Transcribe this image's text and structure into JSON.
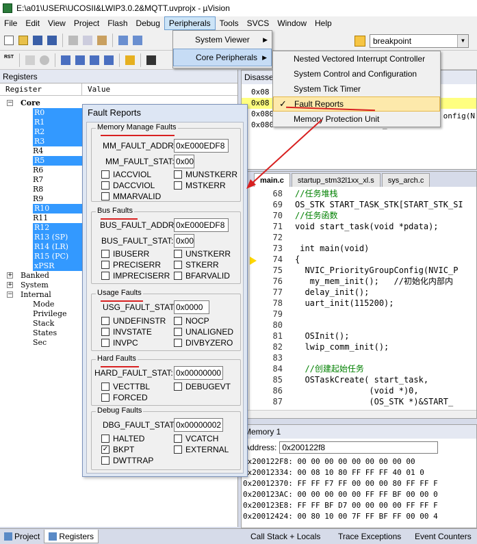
{
  "window": {
    "title": "E:\\a01\\USER\\UCOSII&LWIP3.0.2&MQTT.uvprojx - µVision"
  },
  "menubar": [
    "File",
    "Edit",
    "View",
    "Project",
    "Flash",
    "Debug",
    "Peripherals",
    "Tools",
    "SVCS",
    "Window",
    "Help"
  ],
  "toolbar": {
    "find_value": "breakpoint",
    "reset_label": "RST"
  },
  "peripherals_menu": [
    "System Viewer",
    "Core Peripherals"
  ],
  "core_menu": [
    "Nested Vectored Interrupt Controller",
    "System Control and Configuration",
    "System Tick Timer",
    "Fault Reports",
    "Memory Protection Unit"
  ],
  "registers": {
    "title": "Registers",
    "col_register": "Register",
    "col_value": "Value",
    "core": "Core",
    "core_regs": [
      "R0",
      "R1",
      "R2",
      "R3",
      "R4",
      "R5",
      "R6",
      "R7",
      "R8",
      "R9",
      "R10",
      "R11",
      "R12",
      "R13 (SP)",
      "R14 (LR)",
      "R15 (PC)",
      "xPSR"
    ],
    "banked": "Banked",
    "system": "System",
    "internal": "Internal",
    "internal_items": [
      "Mode",
      "Privilege",
      "Stack",
      "States",
      "Sec"
    ]
  },
  "disasm": {
    "title": "Disassembly",
    "lines": [
      "0x08                                 6,pc}",
      "0x08                                 r}",
      "0x08000282 F44F60A0  MOV      r0,#0x500",
      "0x08000286 F000FA1F  BL.W     NVIC_Priorit"
    ],
    "side": [
      "onfig(N"
    ]
  },
  "editor": {
    "tabs": [
      "main.c",
      "startup_stm32l1xx_xl.s",
      "sys_arch.c"
    ],
    "lines": [
      {
        "n": "68",
        "t": "//任务堆栈"
      },
      {
        "n": "69",
        "t": "OS_STK START_TASK_STK[START_STK_SI"
      },
      {
        "n": "70",
        "t": "//任务函数"
      },
      {
        "n": "71",
        "t": "void start_task(void *pdata);"
      },
      {
        "n": "72",
        "t": ""
      },
      {
        "n": "73",
        "t": " int main(void)"
      },
      {
        "n": "74",
        "t": "{"
      },
      {
        "n": "75",
        "t": "  NVIC_PriorityGroupConfig(NVIC_P"
      },
      {
        "n": "76",
        "t": "   my_mem_init();   //初始化内部内"
      },
      {
        "n": "77",
        "t": "  delay_init();"
      },
      {
        "n": "78",
        "t": "  uart_init(115200);"
      },
      {
        "n": "79",
        "t": ""
      },
      {
        "n": "80",
        "t": ""
      },
      {
        "n": "81",
        "t": "  OSInit();"
      },
      {
        "n": "82",
        "t": "  lwip_comm_init();"
      },
      {
        "n": "83",
        "t": ""
      },
      {
        "n": "84",
        "t": "  //创建起始任务"
      },
      {
        "n": "85",
        "t": "  OSTaskCreate( start_task,"
      },
      {
        "n": "86",
        "t": "               (void *)0,"
      },
      {
        "n": "87",
        "t": "               (OS_STK *)&START_"
      }
    ]
  },
  "memory": {
    "title": "Memory 1",
    "addr_label": "Address:",
    "addr_value": "0x200122f8",
    "lines": [
      "0x200122F8: 00 00 00 00 00 00 00 00 00",
      "0x20012334: 00 08 10 80 FF FF FF 40 01 0",
      "0x20012370: FF FF F7 FF 00 00 00 80 FF FF F",
      "0x200123AC: 00 00 00 00 00 FF FF BF 00 00 0",
      "0x200123E8: FF FF BF D7 00 00 00 00 FF FF F",
      "0x20012424: 00 80 10 00 7F FF BF FF 00 00 4"
    ]
  },
  "bottom_tabs": [
    "Project",
    "Registers",
    "Call Stack + Locals",
    "Trace Exceptions",
    "Event Counters"
  ],
  "fault": {
    "title": "Fault Reports",
    "mm": {
      "title": "Memory Manage Faults",
      "addr_label": "MM_FAULT_ADDR:",
      "addr": "0xE000EDF8",
      "stat_label": "MM_FAULT_STAT:",
      "stat": "0x00",
      "cbs": [
        "IACCVIOL",
        "MUNSTKERR",
        "DACCVIOL",
        "MSTKERR",
        "MMARVALID"
      ]
    },
    "bus": {
      "title": "Bus Faults",
      "addr_label": "BUS_FAULT_ADDR:",
      "addr": "0xE000EDF8",
      "stat_label": "BUS_FAULT_STAT:",
      "stat": "0x00",
      "cbs": [
        "IBUSERR",
        "UNSTKERR",
        "PRECISERR",
        "STKERR",
        "IMPRECISERR",
        "BFARVALID"
      ]
    },
    "usage": {
      "title": "Usage Faults",
      "stat_label": "USG_FAULT_STAT:",
      "stat": "0x0000",
      "cbs": [
        "UNDEFINSTR",
        "NOCP",
        "INVSTATE",
        "UNALIGNED",
        "INVPC",
        "DIVBYZERO"
      ]
    },
    "hard": {
      "title": "Hard Faults",
      "stat_label": "HARD_FAULT_STAT:",
      "stat": "0x00000000",
      "cbs": [
        "VECTTBL",
        "DEBUGEVT",
        "FORCED"
      ]
    },
    "debug": {
      "title": "Debug Faults",
      "stat_label": "DBG_FAULT_STAT:",
      "stat": "0x00000002",
      "cbs": [
        "HALTED",
        "VCATCH",
        "BKPT",
        "EXTERNAL",
        "DWTTRAP"
      ],
      "checked": "BKPT"
    }
  },
  "colors": {
    "accent": "#3399ff",
    "annotation": "#d82020",
    "highlight": "#fde9ab"
  }
}
